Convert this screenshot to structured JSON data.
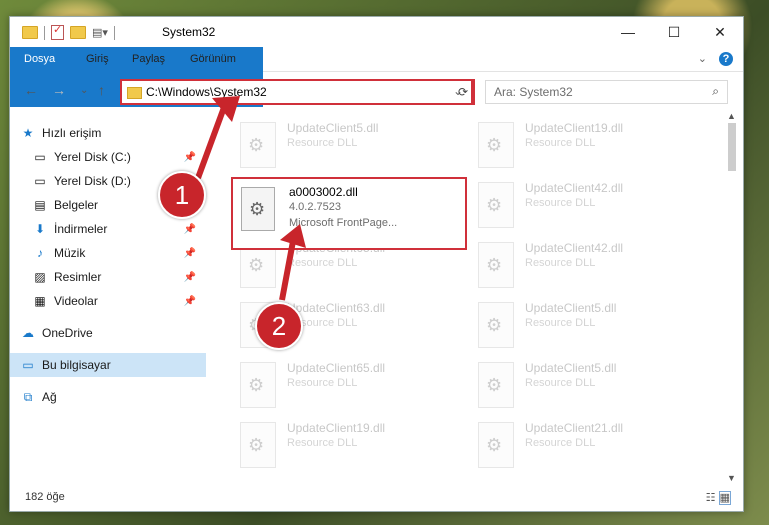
{
  "window": {
    "title": "System32"
  },
  "ribbon": {
    "tabs": [
      "Dosya",
      "Giriş",
      "Paylaş",
      "Görünüm"
    ]
  },
  "address": {
    "path": "C:\\Windows\\System32",
    "search_placeholder": "Ara: System32"
  },
  "sidebar": {
    "items": [
      {
        "label": "Hızlı erişim",
        "icon": "star-icon"
      },
      {
        "label": "Yerel Disk (C:)",
        "icon": "drive-icon"
      },
      {
        "label": "Yerel Disk (D:)",
        "icon": "drive-icon"
      },
      {
        "label": "Belgeler",
        "icon": "document-icon"
      },
      {
        "label": "İndirmeler",
        "icon": "download-icon"
      },
      {
        "label": "Müzik",
        "icon": "music-icon"
      },
      {
        "label": "Resimler",
        "icon": "picture-icon"
      },
      {
        "label": "Videolar",
        "icon": "video-icon"
      },
      {
        "label": "OneDrive",
        "icon": "cloud-icon"
      },
      {
        "label": "Bu bilgisayar",
        "icon": "computer-icon"
      },
      {
        "label": "Ağ",
        "icon": "network-icon"
      }
    ]
  },
  "files": [
    {
      "name": "UpdateClient5.dll",
      "desc": "Resource DLL"
    },
    {
      "name": "UpdateClient19.dll",
      "desc": "Resource DLL"
    },
    {
      "name": "UpdateClient42.dll",
      "desc": "Resource DLL"
    },
    {
      "name": "UpdateClient65.dll",
      "desc": "Resource DLL"
    },
    {
      "name": "UpdateClient42.dll",
      "desc": "Resource DLL"
    },
    {
      "name": "UpdateClient63.dll",
      "desc": "Resource DLL"
    },
    {
      "name": "UpdateClient5.dll",
      "desc": "Resource DLL"
    },
    {
      "name": "UpdateClient65.dll",
      "desc": "Resource DLL"
    },
    {
      "name": "UpdateClient5.dll",
      "desc": "Resource DLL"
    },
    {
      "name": "UpdateClient19.dll",
      "desc": "Resource DLL"
    },
    {
      "name": "UpdateClient21.dll",
      "desc": "Resource DLL"
    }
  ],
  "highlighted_file": {
    "name": "a0003002.dll",
    "version": "4.0.2.7523",
    "company": "Microsoft FrontPage..."
  },
  "status": {
    "count": "182 öğe"
  },
  "badges": {
    "one": "1",
    "two": "2"
  },
  "colors": {
    "accent": "#1979ca",
    "highlight": "#d0303a"
  }
}
